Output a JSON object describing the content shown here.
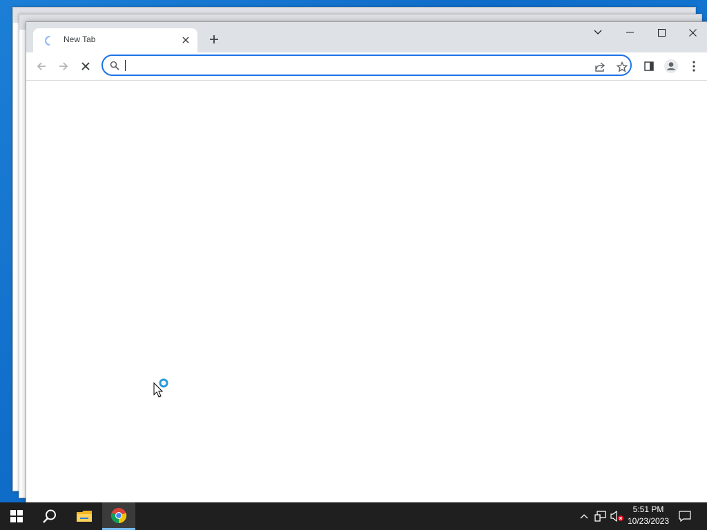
{
  "browser": {
    "tab": {
      "title": "New Tab"
    },
    "omnibox": {
      "value": "",
      "placeholder": ""
    }
  },
  "taskbar": {
    "clock": {
      "time": "5:51 PM",
      "date": "10/23/2023"
    }
  },
  "colors": {
    "accent": "#1a73e8",
    "tabstrip": "#dee1e6",
    "taskbar": "#1f1f1f",
    "desktop": "#1c7fd6"
  },
  "icons": [
    "loading-spinner-icon",
    "close-icon",
    "plus-icon",
    "chevron-down-icon",
    "minimize-icon",
    "maximize-icon",
    "back-arrow-icon",
    "forward-arrow-icon",
    "stop-icon",
    "search-icon",
    "share-icon",
    "star-icon",
    "side-panel-icon",
    "profile-icon",
    "kebab-menu-icon",
    "windows-start-icon",
    "file-explorer-icon",
    "chrome-icon",
    "chevron-up-icon",
    "network-icon",
    "volume-muted-icon",
    "notification-icon"
  ]
}
